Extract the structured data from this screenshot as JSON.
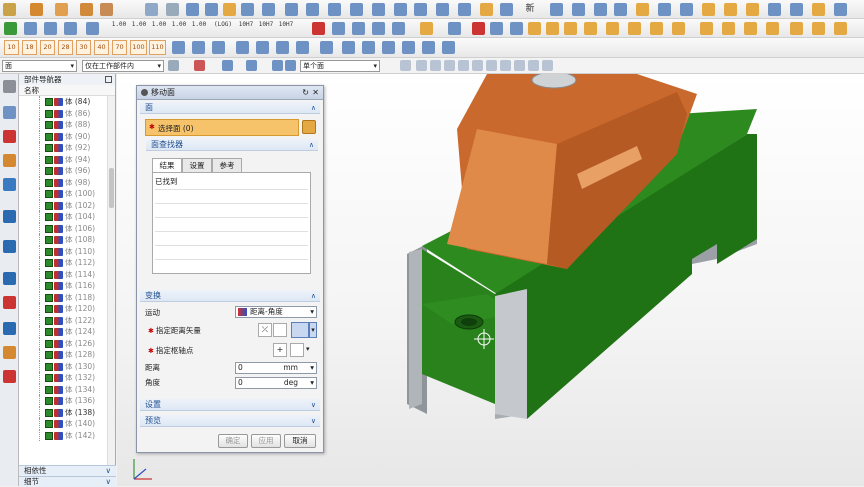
{
  "toolbar": {
    "tolerance_labels": [
      "1.00",
      "1.00",
      "1.00",
      "1.00",
      "1.00",
      "(LOG)",
      "10H7",
      "10H7",
      "10H7"
    ],
    "circle_numbers": [
      "10",
      "18",
      "20",
      "28",
      "30",
      "40",
      "70",
      "100",
      "110"
    ],
    "section_button": "新",
    "filter_select": "面",
    "scope_select": "仅在工作部件内",
    "view_select": "单个面"
  },
  "navigator": {
    "title": "部件导航器",
    "column_name": "名称",
    "rows": [
      {
        "label": "体 (84)",
        "gray": false
      },
      {
        "label": "体 (86)",
        "gray": true
      },
      {
        "label": "体 (88)",
        "gray": true
      },
      {
        "label": "体 (90)",
        "gray": true
      },
      {
        "label": "体 (92)",
        "gray": true
      },
      {
        "label": "体 (94)",
        "gray": true
      },
      {
        "label": "体 (96)",
        "gray": true
      },
      {
        "label": "体 (98)",
        "gray": true
      },
      {
        "label": "体 (100)",
        "gray": true
      },
      {
        "label": "体 (102)",
        "gray": true
      },
      {
        "label": "体 (104)",
        "gray": true
      },
      {
        "label": "体 (106)",
        "gray": true
      },
      {
        "label": "体 (108)",
        "gray": true
      },
      {
        "label": "体 (110)",
        "gray": true
      },
      {
        "label": "体 (112)",
        "gray": true
      },
      {
        "label": "体 (114)",
        "gray": true
      },
      {
        "label": "体 (116)",
        "gray": true
      },
      {
        "label": "体 (118)",
        "gray": true
      },
      {
        "label": "体 (120)",
        "gray": true
      },
      {
        "label": "体 (122)",
        "gray": true
      },
      {
        "label": "体 (124)",
        "gray": true
      },
      {
        "label": "体 (126)",
        "gray": true
      },
      {
        "label": "体 (128)",
        "gray": true
      },
      {
        "label": "体 (130)",
        "gray": true
      },
      {
        "label": "体 (132)",
        "gray": true
      },
      {
        "label": "体 (134)",
        "gray": true
      },
      {
        "label": "体 (136)",
        "gray": true
      },
      {
        "label": "体 (138)",
        "gray": false
      },
      {
        "label": "体 (140)",
        "gray": true
      },
      {
        "label": "体 (142)",
        "gray": true
      }
    ],
    "bottom_dependency": "相依性",
    "bottom_detail": "细节"
  },
  "dialog": {
    "title": "移动面",
    "face_section": "面",
    "select_face": "选择面 (0)",
    "face_finder_section": "面查找器",
    "tabs": [
      "结果",
      "设置",
      "参考"
    ],
    "found_label": "已找到",
    "transform_section": "变换",
    "motion_label": "运动",
    "motion_value": "距离-角度",
    "specify_vector": "指定距离矢量",
    "specify_pivot": "指定枢轴点",
    "distance_label": "距离",
    "distance_value": "0",
    "distance_unit": "mm",
    "angle_label": "角度",
    "angle_value": "0",
    "angle_unit": "deg",
    "settings_section": "设置",
    "preview_section": "预览",
    "ok_button": "确定",
    "apply_button": "应用",
    "cancel_button": "取消"
  },
  "colors": {
    "part_orange": "#d87a3c",
    "part_green": "#2d8a1f",
    "part_gray": "#9aa0a6",
    "accent_orange": "#f6c36a"
  }
}
